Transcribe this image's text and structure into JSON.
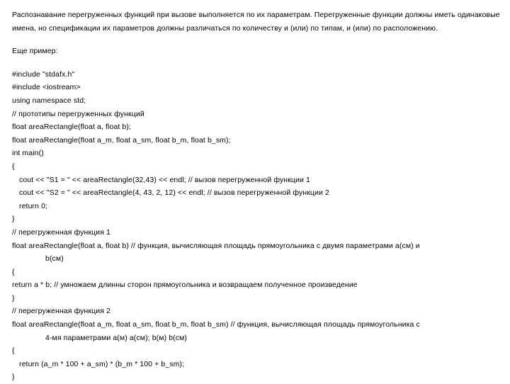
{
  "slide": {
    "intro_paragraph": "Распознавание перегруженных функций при вызове выполняется по их параметрам. Перегруженные функции должны иметь одинаковые имена, но спецификации их параметров должны различаться по количеству и (или) по типам, и (или) по расположению.",
    "example_label": "Еще пример:",
    "code_lines": [
      {
        "text": "#include \"stdafx.h\"",
        "indent": 0
      },
      {
        "text": "#include <iostream>",
        "indent": 0
      },
      {
        "text": "using namespace std;",
        "indent": 0
      },
      {
        "text": "// прототипы перегруженных функций",
        "indent": 0
      },
      {
        "text": "float areaRectangle(float a, float b);",
        "indent": 0
      },
      {
        "text": "float areaRectangle(float a_m, float a_sm, float b_m, float b_sm);",
        "indent": 0
      },
      {
        "text": "int main()",
        "indent": 0
      },
      {
        "text": "{",
        "indent": 0
      },
      {
        "text": "cout << \"S1 = \" << areaRectangle(32,43) << endl; // вызов перегруженной функции 1",
        "indent": 1
      },
      {
        "text": "cout << \"S2 = \" << areaRectangle(4, 43, 2, 12) << endl; // вызов перегруженной функции 2",
        "indent": 1
      },
      {
        "text": "return 0;",
        "indent": 1
      },
      {
        "text": "}",
        "indent": 0
      },
      {
        "text": "// перегруженная функция 1",
        "indent": 0
      },
      {
        "text": "float areaRectangle(float a, float b) // функция, вычисляющая площадь прямоугольника с двумя параметрами a(см) и",
        "indent": 0
      },
      {
        "text": "b(см)",
        "indent": 2
      },
      {
        "text": "{",
        "indent": 0
      },
      {
        "text": "return a * b; // умножаем длинны сторон прямоугольника и возвращаем полученное произведение",
        "indent": 0
      },
      {
        "text": "}",
        "indent": 0
      },
      {
        "text": "// перегруженная функция 2",
        "indent": 0
      },
      {
        "text": "float areaRectangle(float a_m, float a_sm, float b_m, float b_sm) // функция, вычисляющая площадь прямоугольника с",
        "indent": 0
      },
      {
        "text": "4-мя параметрами a(м) a(см); b(м) b(см)",
        "indent": 2
      },
      {
        "text": "{",
        "indent": 0
      },
      {
        "text": "return (a_m * 100 + a_sm) * (b_m * 100 + b_sm);",
        "indent": 1
      },
      {
        "text": "}",
        "indent": 0
      }
    ]
  }
}
